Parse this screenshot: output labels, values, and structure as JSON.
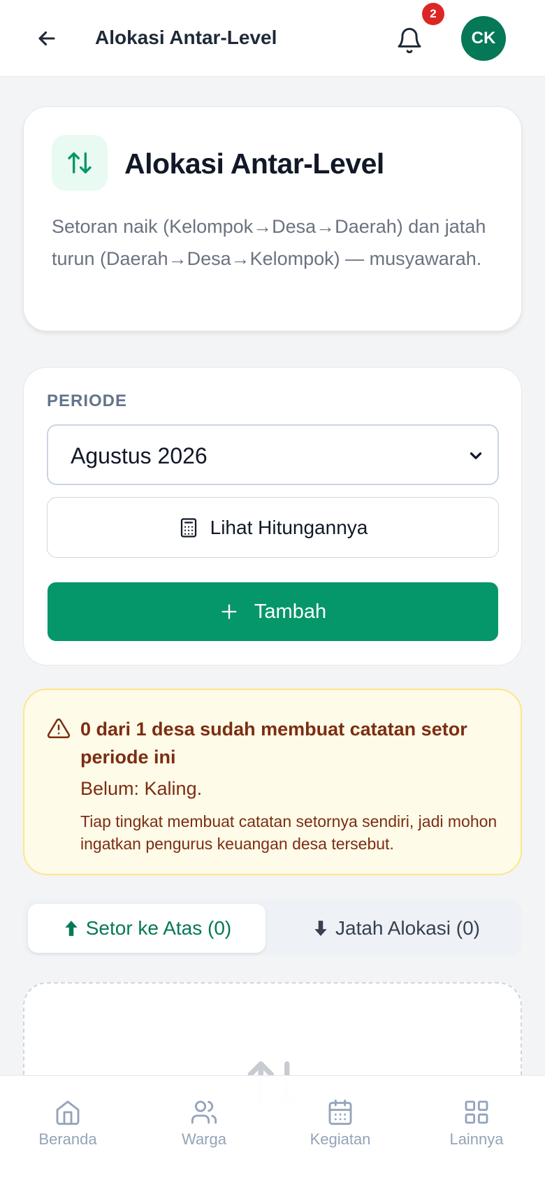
{
  "header": {
    "title": "Alokasi Antar-Level",
    "notification_count": "2",
    "avatar_initials": "CK"
  },
  "intro": {
    "title": "Alokasi Antar-Level",
    "description": "Setoran naik (Kelompok→Desa→Daerah) dan jatah turun (Daerah→Desa→Kelompok) — musyawarah.",
    "icon": "arrows-up-down-icon"
  },
  "period": {
    "label": "PERIODE",
    "selected": "Agustus 2026",
    "calc_button": "Lihat Hitungannya",
    "add_button": "Tambah"
  },
  "warning": {
    "title": "0 dari 1 desa sudah membuat catatan setor periode ini",
    "belum": "Belum: Kaling.",
    "note": "Tiap tingkat membuat catatan setornya sendiri, jadi mohon ingatkan pengurus keuangan desa tersebut."
  },
  "tabs": [
    {
      "label": "Setor ke Atas (0)",
      "icon": "arrow-up-icon",
      "active": true
    },
    {
      "label": "Jatah Alokasi (0)",
      "icon": "arrow-down-icon",
      "active": false
    }
  ],
  "bottom_nav": [
    {
      "label": "Beranda",
      "icon": "home-icon"
    },
    {
      "label": "Warga",
      "icon": "users-icon"
    },
    {
      "label": "Kegiatan",
      "icon": "calendar-icon"
    },
    {
      "label": "Lainnya",
      "icon": "grid-icon"
    }
  ],
  "colors": {
    "primary": "#059669",
    "primary_dark": "#047857",
    "warning_bg": "#fefbe8",
    "warning_text": "#7c2d12",
    "badge": "#dc2626"
  }
}
